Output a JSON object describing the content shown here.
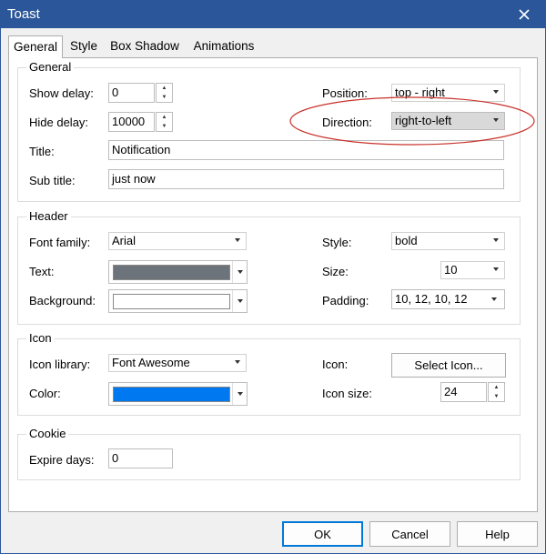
{
  "window": {
    "title": "Toast"
  },
  "tabs": [
    "General",
    "Style",
    "Box Shadow",
    "Animations"
  ],
  "general": {
    "group_title": "General",
    "show_delay": {
      "label": "Show delay:",
      "value": "0"
    },
    "hide_delay": {
      "label": "Hide delay:",
      "value": "10000"
    },
    "title": {
      "label": "Title:",
      "value": "Notification"
    },
    "sub_title": {
      "label": "Sub title:",
      "value": "just now"
    },
    "position": {
      "label": "Position:",
      "value": "top - right"
    },
    "direction": {
      "label": "Direction:",
      "value": "right-to-left"
    }
  },
  "header": {
    "group_title": "Header",
    "font_family": {
      "label": "Font family:",
      "value": "Arial"
    },
    "text": {
      "label": "Text:",
      "color": "#6d737b"
    },
    "background": {
      "label": "Background:",
      "color": "#ffffff"
    },
    "style": {
      "label": "Style:",
      "value": "bold"
    },
    "size": {
      "label": "Size:",
      "value": "10"
    },
    "padding": {
      "label": "Padding:",
      "value": "10, 12, 10, 12"
    }
  },
  "icon": {
    "group_title": "Icon",
    "library": {
      "label": "Icon library:",
      "value": "Font Awesome"
    },
    "color": {
      "label": "Color:",
      "color": "#0078f0"
    },
    "icon": {
      "label": "Icon:",
      "button_label": "Select Icon..."
    },
    "size": {
      "label": "Icon size:",
      "value": "24"
    }
  },
  "cookie": {
    "group_title": "Cookie",
    "expire_days": {
      "label": "Expire days:",
      "value": "0"
    }
  },
  "buttons": {
    "ok": "OK",
    "cancel": "Cancel",
    "help": "Help"
  },
  "colors": {
    "titlebar": "#2b579a",
    "annotation": "#c8312a",
    "accent": "#0078d7"
  }
}
